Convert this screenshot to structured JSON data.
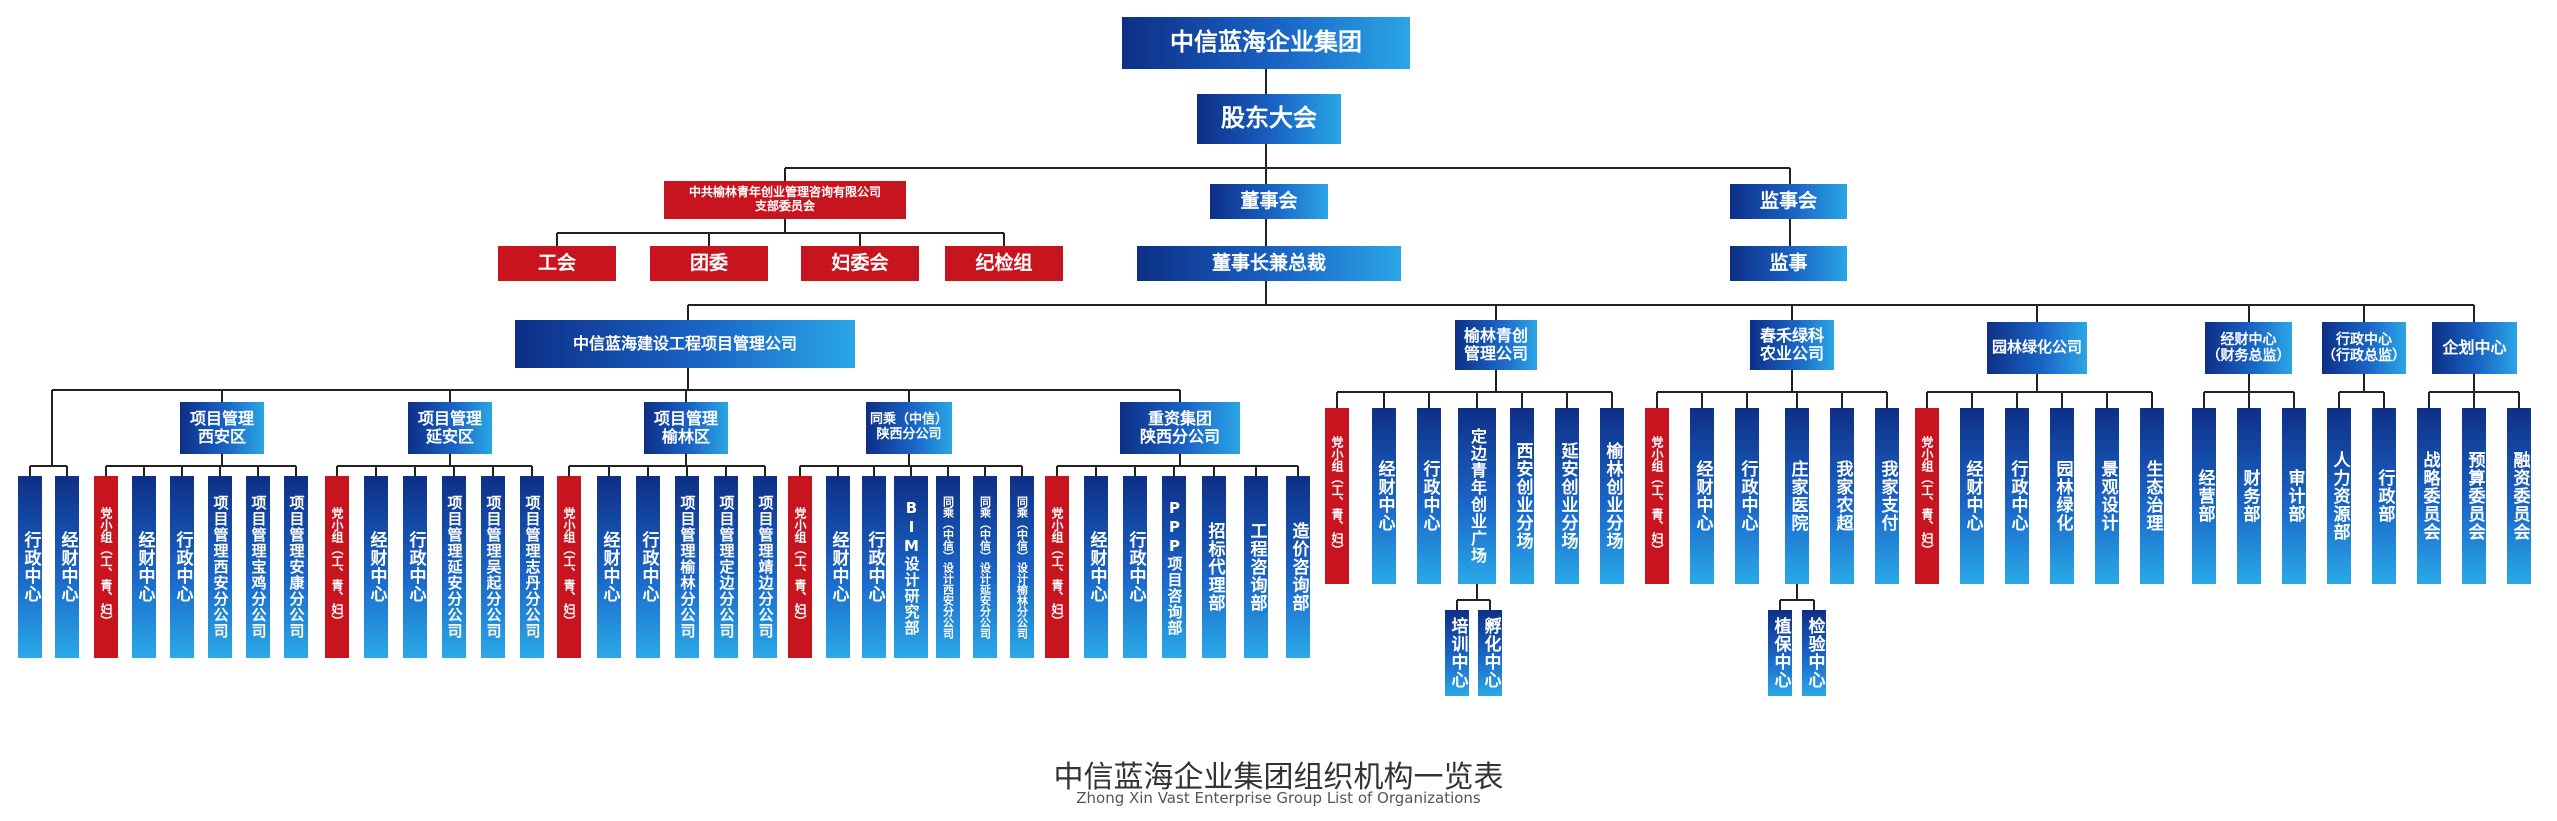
{
  "title_cn": "中信蓝海企业集团组织机构一览表",
  "title_en": "Zhong Xin Vast Enterprise Group List of Organizations",
  "colors": {
    "blue_dark": "#0d2f86",
    "blue_light": "#2aa6e6",
    "red": "#c8141e",
    "line": "#222222"
  },
  "top": {
    "group": "中信蓝海企业集团",
    "shareholders": "股东大会",
    "party_branch": "中共榆林青年创业管理咨询有限公司\n支部委员会",
    "board": "董事会",
    "chairman": "董事长兼总裁",
    "supervisory_board": "监事会",
    "supervisor": "监事"
  },
  "party_orgs": [
    "工会",
    "团委",
    "妇委会",
    "纪检组"
  ],
  "project_company": "中信蓝海建设工程项目管理公司",
  "regions": [
    {
      "name": "项目管理\n西安区",
      "children": [
        "行政中心",
        "经财中心"
      ]
    },
    {
      "name": "项目管理\n西安区",
      "children": [
        "党小组（工、青、妇）",
        "经财中心",
        "行政中心",
        "项目管理西安分公司",
        "项目管理宝鸡分公司",
        "项目管理安康分公司"
      ]
    },
    {
      "name": "项目管理\n延安区",
      "children": [
        "党小组（工、青、妇）",
        "经财中心",
        "行政中心",
        "项目管理延安分公司",
        "项目管理吴起分公司",
        "项目管理志丹分公司"
      ]
    },
    {
      "name": "项目管理\n榆林区",
      "children": [
        "党小组（工、青、妇）",
        "经财中心",
        "行政中心",
        "项目管理榆林分公司",
        "项目管理定边分公司",
        "项目管理靖边分公司"
      ]
    },
    {
      "name": "同乘（中信）\n陕西分公司",
      "children": [
        "党小组（工、青、妇）",
        "经财中心",
        "行政中心",
        "BIM设计研究部",
        "同乘（中信）设计西安分公司",
        "同乘（中信）设计延安分公司",
        "同乘（中信）设计榆林分公司"
      ]
    },
    {
      "name": "重资集团\n陕西分公司",
      "children": [
        "党小组（工、青、妇）",
        "经财中心",
        "行政中心",
        "PPP项目咨询部",
        "招标代理部",
        "工程咨询部",
        "造价咨询部"
      ]
    }
  ],
  "yulin": {
    "name": "榆林青创\n管理公司",
    "children": [
      "党小组（工、青、妇）",
      "经财中心",
      "行政中心",
      "定边青年创业广场",
      "西安创业分场",
      "延安创业分场",
      "榆林创业分场"
    ],
    "sub": [
      "培训中心",
      "孵化中心"
    ]
  },
  "chunhe": {
    "name": "春禾绿科\n农业公司",
    "children": [
      "党小组（工、青、妇）",
      "经财中心",
      "行政中心",
      "庄家医院",
      "我家农超",
      "我家支付"
    ],
    "sub": [
      "植保中心",
      "检验中心"
    ]
  },
  "garden": {
    "name": "园林绿化公司",
    "children": [
      "党小组（工、青、妇）",
      "经财中心",
      "行政中心",
      "园林绿化",
      "景观设计",
      "生态治理"
    ]
  },
  "finance": {
    "name": "经财中心\n（财务总监）",
    "children": [
      "经营部",
      "财务部",
      "审计部"
    ]
  },
  "admin": {
    "name": "行政中心\n（行政总监）",
    "children": [
      "人力资源部",
      "行政部"
    ]
  },
  "planning": {
    "name": "企划中心",
    "children": [
      "战略委员会",
      "预算委员会",
      "融资委员会"
    ]
  }
}
